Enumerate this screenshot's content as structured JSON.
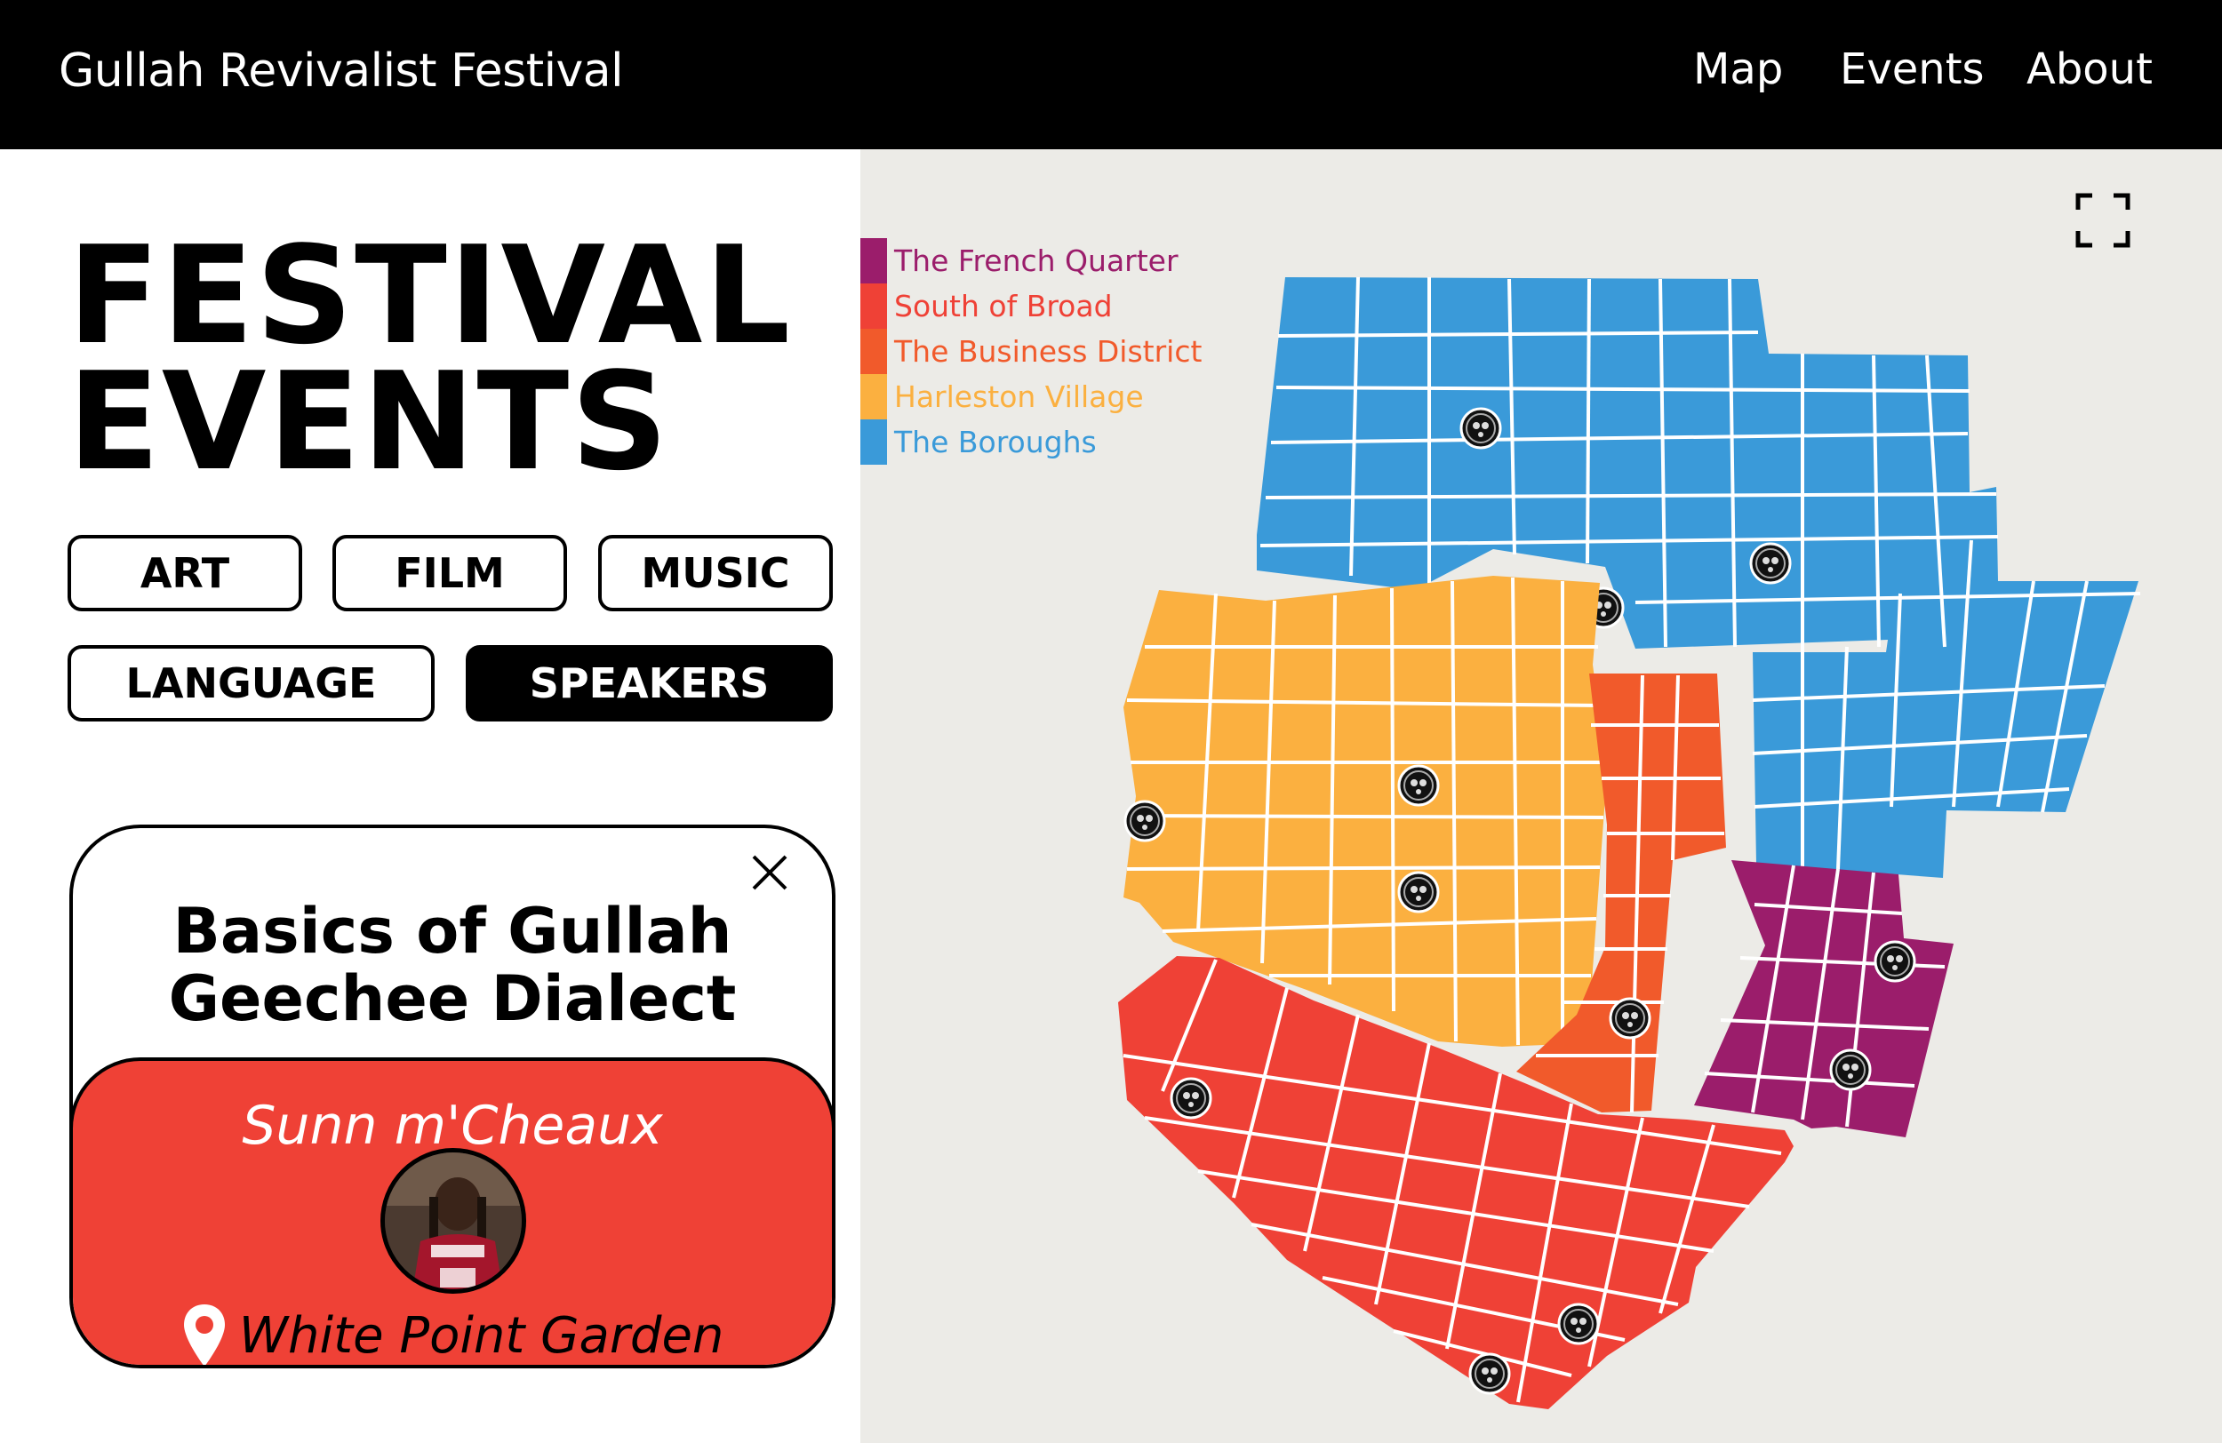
{
  "header": {
    "title": "Gullah Revivalist Festival",
    "nav": {
      "map": "Map",
      "events": "Events",
      "about": "About"
    }
  },
  "page": {
    "heading_line1": "FESTIVAL",
    "heading_line2": "EVENTS"
  },
  "filters": [
    {
      "label": "ART",
      "active": false
    },
    {
      "label": "FILM",
      "active": false
    },
    {
      "label": "MUSIC",
      "active": false
    },
    {
      "label": "LANGUAGE",
      "active": false
    },
    {
      "label": "SPEAKERS",
      "active": true
    }
  ],
  "event_card": {
    "title_line1": "Basics of Gullah",
    "title_line2": "Geechee Dialect",
    "speaker": "Sunn m'Cheaux",
    "location": "White Point Garden",
    "accent_color": "#ef4136"
  },
  "map": {
    "legend": [
      {
        "label": "The French Quarter",
        "color": "#9b1d6b"
      },
      {
        "label": "South of Broad",
        "color": "#ef4136"
      },
      {
        "label": "The Business District",
        "color": "#f15a2b"
      },
      {
        "label": "Harleston Village",
        "color": "#fbb040"
      },
      {
        "label": "The Boroughs",
        "color": "#3a9ad9"
      }
    ],
    "marker_icon": "event-marker-icon",
    "fullscreen_icon": "fullscreen-icon"
  }
}
